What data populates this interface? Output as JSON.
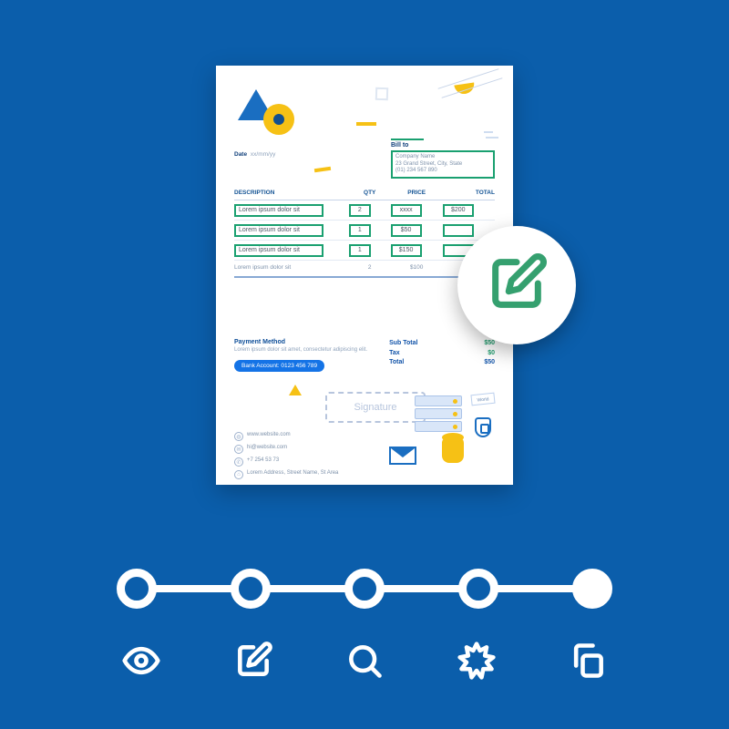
{
  "invoice": {
    "date_label": "Date",
    "date_value": "xx/mm/yy",
    "bill_to": {
      "title": "Bill to",
      "fields": [
        "Company Name",
        "23 Grand Street, City, State",
        "(01) 234 567 890"
      ]
    },
    "headers": {
      "c1": "DESCRIPTION",
      "c2": "QTY",
      "c3": "PRICE",
      "c4": "TOTAL"
    },
    "rows": [
      {
        "desc": "Lorem ipsum dolor sit",
        "qty": "2",
        "price": "xxxx",
        "total": "$200"
      },
      {
        "desc": "Lorem ipsum dolor sit",
        "qty": "1",
        "price": "$50",
        "total": ""
      },
      {
        "desc": "Lorem ipsum dolor sit",
        "qty": "1",
        "price": "$150",
        "total": ""
      }
    ],
    "summary_row": {
      "desc": "Lorem ipsum dolor sit",
      "qty": "2",
      "price": "$100",
      "total": ""
    },
    "payment": {
      "title": "Payment Method",
      "text": "Lorem ipsum dolor sit amet, consectetur adipiscing elit.",
      "account": "Bank Account: 0123 456 789"
    },
    "totals": {
      "subtotal_label": "Sub Total",
      "subtotal": "$50",
      "tax_label": "Tax",
      "tax": "$0",
      "total_label": "Total",
      "total": "$50"
    },
    "signature": "Signature",
    "contact": {
      "web": "www.website.com",
      "mail": "hi@website.com",
      "phone": "+7 254 53 73",
      "addr": "Lorem Address, Street Name, St Area"
    },
    "flag": "World"
  },
  "stepper": {
    "steps": 5,
    "active_index": 4
  },
  "tools": [
    "view",
    "edit",
    "search",
    "badge",
    "copy"
  ]
}
